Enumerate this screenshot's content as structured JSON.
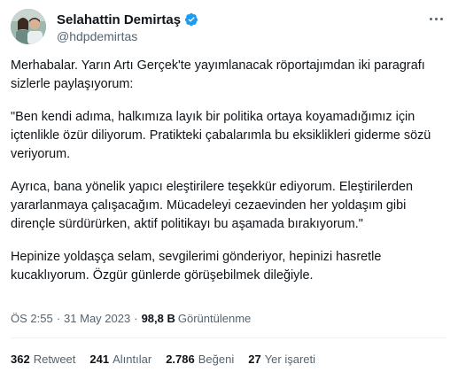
{
  "author": {
    "display_name": "Selahattin Demirtaş",
    "handle": "@hdpdemirtas",
    "verified_color": "#1d9bf0"
  },
  "tweet": {
    "paragraphs": [
      "Merhabalar. Yarın Artı Gerçek'te yayımlanacak röportajımdan iki paragrafı sizlerle paylaşıyorum:",
      "\"Ben kendi adıma, halkımıza layık bir politika ortaya koyamadığımız için içtenlikle özür diliyorum. Pratikteki çabalarımla bu eksiklikleri giderme sözü veriyorum.",
      "Ayrıca, bana yönelik yapıcı eleştirilere teşekkür ediyorum. Eleştirilerden yararlanmaya çalışacağım. Mücadeleyi cezaevinden her yoldaşım gibi dirençle sürdürürken, aktif politikayı bu aşamada bırakıyorum.\"",
      "Hepinize yoldaşça selam, sevgilerimi gönderiyor, hepinizi hasretle kucaklıyorum. Özgür günlerde görüşebilmek dileğiyle."
    ],
    "time": "ÖS 2:55",
    "date": "31 May 2023",
    "separator": "·",
    "views_count": "98,8 B",
    "views_label": "Görüntülenme"
  },
  "stats": [
    {
      "count": "362",
      "label": "Retweet"
    },
    {
      "count": "241",
      "label": "Alıntılar"
    },
    {
      "count": "2.786",
      "label": "Beğeni"
    },
    {
      "count": "27",
      "label": "Yer işareti"
    }
  ],
  "icons": {
    "more": "more-icon",
    "verified": "verified-badge-icon"
  }
}
